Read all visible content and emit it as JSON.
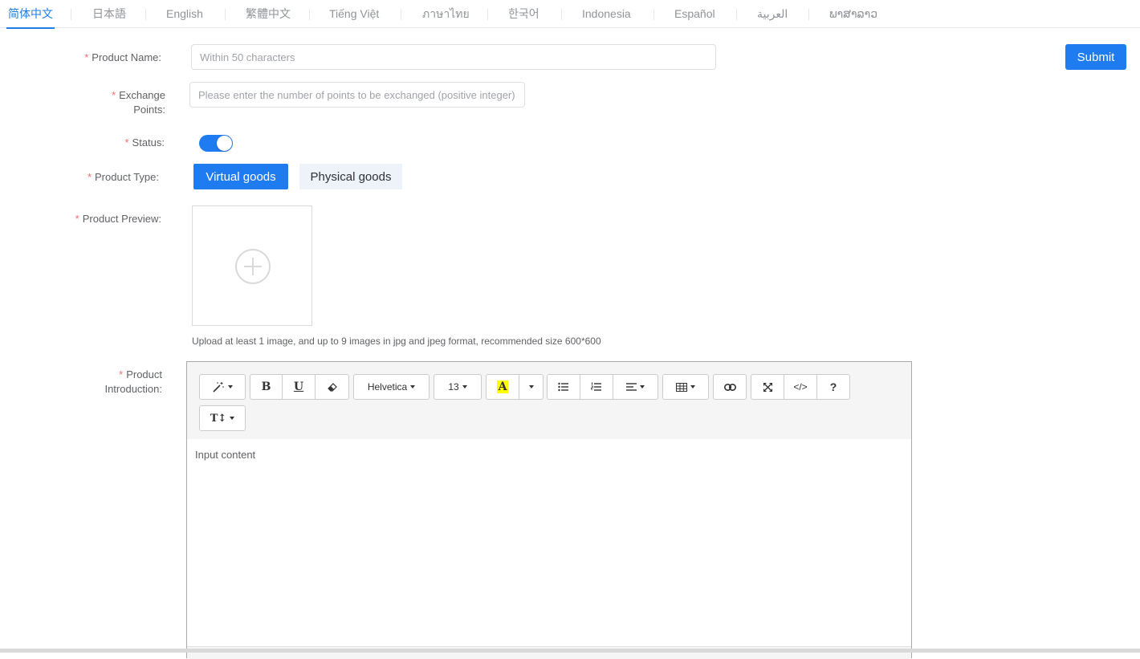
{
  "language_tabs": [
    {
      "label": "简体中文",
      "active": true
    },
    {
      "label": "日本語",
      "active": false
    },
    {
      "label": "English",
      "active": false
    },
    {
      "label": "繁體中文",
      "active": false
    },
    {
      "label": "Tiếng Việt",
      "active": false
    },
    {
      "label": "ภาษาไทย",
      "active": false
    },
    {
      "label": "한국어",
      "active": false
    },
    {
      "label": "Indonesia",
      "active": false
    },
    {
      "label": "Español",
      "active": false
    },
    {
      "label": "العربية",
      "active": false
    },
    {
      "label": "ພາສາລາວ",
      "active": false
    }
  ],
  "form": {
    "required_mark": "*",
    "product_name": {
      "label": "Product Name:",
      "placeholder": "Within 50 characters",
      "value": ""
    },
    "exchange_points": {
      "label_line1": "Exchange",
      "label_line2": "Points:",
      "placeholder": "Please enter the number of points to be exchanged (positive integer)",
      "value": ""
    },
    "status": {
      "label": "Status:",
      "on": true
    },
    "product_type": {
      "label": "Product Type:",
      "options": [
        "Virtual goods",
        "Physical goods"
      ],
      "selected": "Virtual goods"
    },
    "product_preview": {
      "label": "Product Preview:",
      "hint": "Upload at least 1 image, and up to 9 images in jpg and jpeg format, recommended size 600*600"
    },
    "product_introduction": {
      "label_line1": "Product",
      "label_line2": "Introduction:",
      "placeholder": "Input content"
    }
  },
  "submit_label": "Submit",
  "editor_toolbar": {
    "font_family": "Helvetica",
    "font_size": "13",
    "highlight_letter": "A",
    "bold": "B",
    "underline": "U",
    "code": "</>",
    "help": "?",
    "text_height": "T↕"
  },
  "colors": {
    "primary": "#1e7cf0",
    "required": "#f56c6c",
    "highlight_yellow": "#ffff00"
  }
}
